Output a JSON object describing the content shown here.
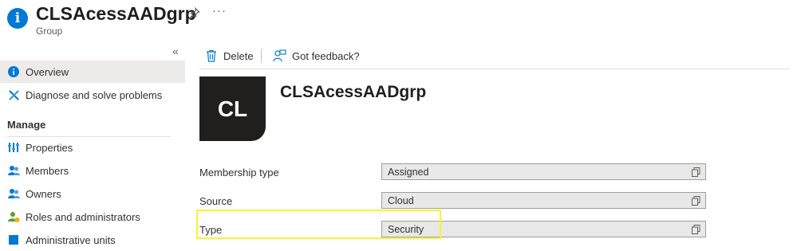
{
  "header": {
    "title": "CLSAcessAADgrp",
    "subtitle": "Group",
    "icon": "info-icon",
    "more_label": "···"
  },
  "sidebar": {
    "collapse_label": "«",
    "items": [
      {
        "label": "Overview",
        "icon": "info-icon",
        "selected": true
      },
      {
        "label": "Diagnose and solve problems",
        "icon": "wrench-icon"
      }
    ],
    "section_title": "Manage",
    "manage_items": [
      {
        "label": "Properties",
        "icon": "properties-icon"
      },
      {
        "label": "Members",
        "icon": "members-icon"
      },
      {
        "label": "Owners",
        "icon": "owners-icon"
      },
      {
        "label": "Roles and administrators",
        "icon": "roles-icon"
      },
      {
        "label": "Administrative units",
        "icon": "admin-units-icon"
      }
    ]
  },
  "toolbar": {
    "delete_label": "Delete",
    "feedback_label": "Got feedback?"
  },
  "group": {
    "avatar_initials": "CL",
    "name": "CLSAcessAADgrp"
  },
  "properties": [
    {
      "label": "Membership type",
      "value": "Assigned"
    },
    {
      "label": "Source",
      "value": "Cloud"
    },
    {
      "label": "Type",
      "value": "Security"
    }
  ],
  "colors": {
    "accent": "#0078d4",
    "highlight": "#f6f62a",
    "avatar_bg": "#201f1e"
  }
}
